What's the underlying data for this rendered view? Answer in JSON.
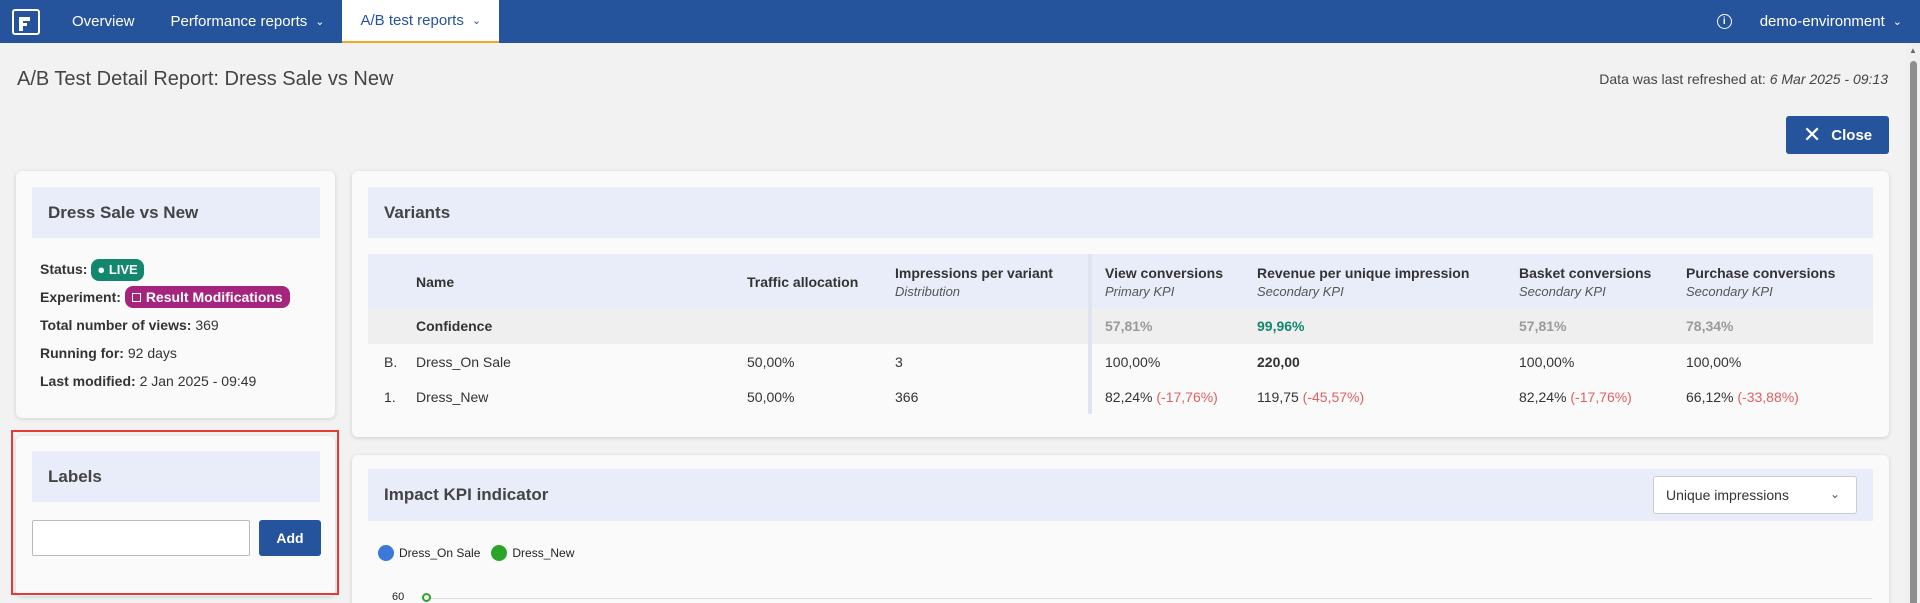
{
  "nav": {
    "items": [
      {
        "label": "Overview"
      },
      {
        "label": "Performance reports"
      },
      {
        "label": "A/B test reports"
      }
    ],
    "environment": "demo-environment"
  },
  "header": {
    "title": "A/B Test Detail Report: Dress Sale vs New",
    "refresh_label": "Data was last refreshed at:",
    "refresh_value": "6 Mar 2025 - 09:13",
    "close_label": "Close"
  },
  "info": {
    "title": "Dress Sale vs New",
    "status_label": "Status:",
    "status_value": "LIVE",
    "experiment_label": "Experiment:",
    "experiment_value": "Result Modifications",
    "views_label": "Total number of views:",
    "views_value": "369",
    "running_label": "Running for:",
    "running_value": "92 days",
    "modified_label": "Last modified:",
    "modified_value": "2 Jan 2025 - 09:49"
  },
  "labels": {
    "title": "Labels",
    "input_value": "",
    "add_label": "Add"
  },
  "variants": {
    "title": "Variants",
    "columns": {
      "name": "Name",
      "traffic": "Traffic allocation",
      "impressions": "Impressions per variant",
      "impressions_sub": "Distribution",
      "view": "View conversions",
      "view_sub": "Primary KPI",
      "revenue": "Revenue per unique impression",
      "revenue_sub": "Secondary KPI",
      "basket": "Basket conversions",
      "basket_sub": "Secondary KPI",
      "purchase": "Purchase conversions",
      "purchase_sub": "Secondary KPI"
    },
    "confidence": {
      "label": "Confidence",
      "view": "57,81%",
      "revenue": "99,96%",
      "basket": "57,81%",
      "purchase": "78,34%"
    },
    "rows": [
      {
        "rank": "B.",
        "name": "Dress_On Sale",
        "traffic": "50,00%",
        "impressions": "3",
        "view": "100,00%",
        "view_delta": "",
        "revenue": "220,00",
        "revenue_delta": "",
        "basket": "100,00%",
        "basket_delta": "",
        "purchase": "100,00%",
        "purchase_delta": ""
      },
      {
        "rank": "1.",
        "name": "Dress_New",
        "traffic": "50,00%",
        "impressions": "366",
        "view": "82,24%",
        "view_delta": "(-17,76%)",
        "revenue": "119,75",
        "revenue_delta": "(-45,57%)",
        "basket": "82,24%",
        "basket_delta": "(-17,76%)",
        "purchase": "66,12%",
        "purchase_delta": "(-33,88%)"
      }
    ]
  },
  "impact": {
    "title": "Impact KPI indicator",
    "dropdown_value": "Unique impressions",
    "legend": [
      {
        "name": "Dress_On Sale",
        "color": "#3b78d8"
      },
      {
        "name": "Dress_New",
        "color": "#2aa52a"
      }
    ],
    "y_tick": "60"
  },
  "colors": {
    "nav_bg": "#26549c",
    "live": "#12876e",
    "experiment": "#a5247e",
    "negative": "#e06060",
    "highlight": "#e53935"
  }
}
